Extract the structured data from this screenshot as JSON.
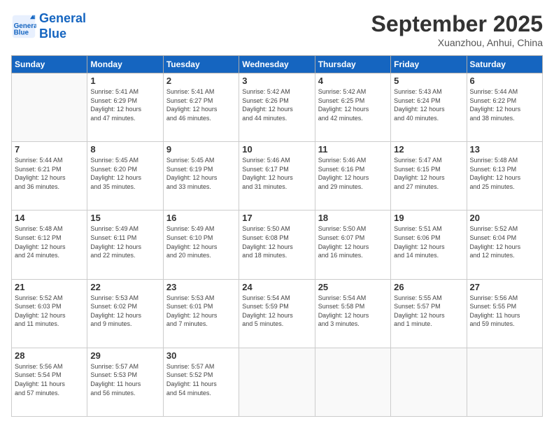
{
  "header": {
    "logo_line1": "General",
    "logo_line2": "Blue",
    "month": "September 2025",
    "location": "Xuanzhou, Anhui, China"
  },
  "weekdays": [
    "Sunday",
    "Monday",
    "Tuesday",
    "Wednesday",
    "Thursday",
    "Friday",
    "Saturday"
  ],
  "weeks": [
    [
      {
        "day": "",
        "info": ""
      },
      {
        "day": "1",
        "info": "Sunrise: 5:41 AM\nSunset: 6:29 PM\nDaylight: 12 hours\nand 47 minutes."
      },
      {
        "day": "2",
        "info": "Sunrise: 5:41 AM\nSunset: 6:27 PM\nDaylight: 12 hours\nand 46 minutes."
      },
      {
        "day": "3",
        "info": "Sunrise: 5:42 AM\nSunset: 6:26 PM\nDaylight: 12 hours\nand 44 minutes."
      },
      {
        "day": "4",
        "info": "Sunrise: 5:42 AM\nSunset: 6:25 PM\nDaylight: 12 hours\nand 42 minutes."
      },
      {
        "day": "5",
        "info": "Sunrise: 5:43 AM\nSunset: 6:24 PM\nDaylight: 12 hours\nand 40 minutes."
      },
      {
        "day": "6",
        "info": "Sunrise: 5:44 AM\nSunset: 6:22 PM\nDaylight: 12 hours\nand 38 minutes."
      }
    ],
    [
      {
        "day": "7",
        "info": "Sunrise: 5:44 AM\nSunset: 6:21 PM\nDaylight: 12 hours\nand 36 minutes."
      },
      {
        "day": "8",
        "info": "Sunrise: 5:45 AM\nSunset: 6:20 PM\nDaylight: 12 hours\nand 35 minutes."
      },
      {
        "day": "9",
        "info": "Sunrise: 5:45 AM\nSunset: 6:19 PM\nDaylight: 12 hours\nand 33 minutes."
      },
      {
        "day": "10",
        "info": "Sunrise: 5:46 AM\nSunset: 6:17 PM\nDaylight: 12 hours\nand 31 minutes."
      },
      {
        "day": "11",
        "info": "Sunrise: 5:46 AM\nSunset: 6:16 PM\nDaylight: 12 hours\nand 29 minutes."
      },
      {
        "day": "12",
        "info": "Sunrise: 5:47 AM\nSunset: 6:15 PM\nDaylight: 12 hours\nand 27 minutes."
      },
      {
        "day": "13",
        "info": "Sunrise: 5:48 AM\nSunset: 6:13 PM\nDaylight: 12 hours\nand 25 minutes."
      }
    ],
    [
      {
        "day": "14",
        "info": "Sunrise: 5:48 AM\nSunset: 6:12 PM\nDaylight: 12 hours\nand 24 minutes."
      },
      {
        "day": "15",
        "info": "Sunrise: 5:49 AM\nSunset: 6:11 PM\nDaylight: 12 hours\nand 22 minutes."
      },
      {
        "day": "16",
        "info": "Sunrise: 5:49 AM\nSunset: 6:10 PM\nDaylight: 12 hours\nand 20 minutes."
      },
      {
        "day": "17",
        "info": "Sunrise: 5:50 AM\nSunset: 6:08 PM\nDaylight: 12 hours\nand 18 minutes."
      },
      {
        "day": "18",
        "info": "Sunrise: 5:50 AM\nSunset: 6:07 PM\nDaylight: 12 hours\nand 16 minutes."
      },
      {
        "day": "19",
        "info": "Sunrise: 5:51 AM\nSunset: 6:06 PM\nDaylight: 12 hours\nand 14 minutes."
      },
      {
        "day": "20",
        "info": "Sunrise: 5:52 AM\nSunset: 6:04 PM\nDaylight: 12 hours\nand 12 minutes."
      }
    ],
    [
      {
        "day": "21",
        "info": "Sunrise: 5:52 AM\nSunset: 6:03 PM\nDaylight: 12 hours\nand 11 minutes."
      },
      {
        "day": "22",
        "info": "Sunrise: 5:53 AM\nSunset: 6:02 PM\nDaylight: 12 hours\nand 9 minutes."
      },
      {
        "day": "23",
        "info": "Sunrise: 5:53 AM\nSunset: 6:01 PM\nDaylight: 12 hours\nand 7 minutes."
      },
      {
        "day": "24",
        "info": "Sunrise: 5:54 AM\nSunset: 5:59 PM\nDaylight: 12 hours\nand 5 minutes."
      },
      {
        "day": "25",
        "info": "Sunrise: 5:54 AM\nSunset: 5:58 PM\nDaylight: 12 hours\nand 3 minutes."
      },
      {
        "day": "26",
        "info": "Sunrise: 5:55 AM\nSunset: 5:57 PM\nDaylight: 12 hours\nand 1 minute."
      },
      {
        "day": "27",
        "info": "Sunrise: 5:56 AM\nSunset: 5:55 PM\nDaylight: 11 hours\nand 59 minutes."
      }
    ],
    [
      {
        "day": "28",
        "info": "Sunrise: 5:56 AM\nSunset: 5:54 PM\nDaylight: 11 hours\nand 57 minutes."
      },
      {
        "day": "29",
        "info": "Sunrise: 5:57 AM\nSunset: 5:53 PM\nDaylight: 11 hours\nand 56 minutes."
      },
      {
        "day": "30",
        "info": "Sunrise: 5:57 AM\nSunset: 5:52 PM\nDaylight: 11 hours\nand 54 minutes."
      },
      {
        "day": "",
        "info": ""
      },
      {
        "day": "",
        "info": ""
      },
      {
        "day": "",
        "info": ""
      },
      {
        "day": "",
        "info": ""
      }
    ]
  ]
}
